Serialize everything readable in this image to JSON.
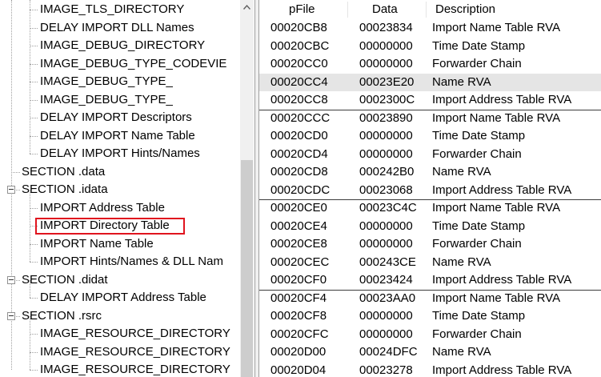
{
  "tree": {
    "items": [
      {
        "label": "IMAGE_TLS_DIRECTORY",
        "level": 2
      },
      {
        "label": "DELAY IMPORT DLL Names",
        "level": 2
      },
      {
        "label": "IMAGE_DEBUG_DIRECTORY",
        "level": 2
      },
      {
        "label": "IMAGE_DEBUG_TYPE_CODEVIE",
        "level": 2
      },
      {
        "label": "IMAGE_DEBUG_TYPE_",
        "level": 2
      },
      {
        "label": "IMAGE_DEBUG_TYPE_",
        "level": 2
      },
      {
        "label": "DELAY IMPORT Descriptors",
        "level": 2
      },
      {
        "label": "DELAY IMPORT Name Table",
        "level": 2
      },
      {
        "label": "DELAY IMPORT Hints/Names",
        "level": 2
      },
      {
        "label": "SECTION .data",
        "level": 1
      },
      {
        "label": "SECTION .idata",
        "level": 1,
        "expanded": true
      },
      {
        "label": "IMPORT Address Table",
        "level": 2
      },
      {
        "label": "IMPORT Directory Table",
        "level": 2,
        "selected": true
      },
      {
        "label": "IMPORT Name Table",
        "level": 2
      },
      {
        "label": "IMPORT Hints/Names & DLL Nam",
        "level": 2
      },
      {
        "label": "SECTION .didat",
        "level": 1,
        "expanded": true
      },
      {
        "label": "DELAY IMPORT Address Table",
        "level": 2
      },
      {
        "label": "SECTION .rsrc",
        "level": 1,
        "expanded": true
      },
      {
        "label": "IMAGE_RESOURCE_DIRECTORY",
        "level": 2
      },
      {
        "label": "IMAGE_RESOURCE_DIRECTORY",
        "level": 2
      },
      {
        "label": "IMAGE_RESOURCE_DIRECTORY",
        "level": 2
      }
    ]
  },
  "table": {
    "columns": [
      "pFile",
      "Data",
      "Description"
    ],
    "rows": [
      {
        "pfile": "00020CB8",
        "data": "00023834",
        "desc": "Import Name Table RVA"
      },
      {
        "pfile": "00020CBC",
        "data": "00000000",
        "desc": "Time Date Stamp"
      },
      {
        "pfile": "00020CC0",
        "data": "00000000",
        "desc": "Forwarder Chain"
      },
      {
        "pfile": "00020CC4",
        "data": "00023E20",
        "desc": "Name RVA",
        "highlight": true
      },
      {
        "pfile": "00020CC8",
        "data": "0002300C",
        "desc": "Import Address Table RVA"
      },
      {
        "pfile": "00020CCC",
        "data": "00023890",
        "desc": "Import Name Table RVA",
        "group_start": true
      },
      {
        "pfile": "00020CD0",
        "data": "00000000",
        "desc": "Time Date Stamp"
      },
      {
        "pfile": "00020CD4",
        "data": "00000000",
        "desc": "Forwarder Chain"
      },
      {
        "pfile": "00020CD8",
        "data": "000242B0",
        "desc": "Name RVA"
      },
      {
        "pfile": "00020CDC",
        "data": "00023068",
        "desc": "Import Address Table RVA"
      },
      {
        "pfile": "00020CE0",
        "data": "00023C4C",
        "desc": "Import Name Table RVA",
        "group_start": true
      },
      {
        "pfile": "00020CE4",
        "data": "00000000",
        "desc": "Time Date Stamp"
      },
      {
        "pfile": "00020CE8",
        "data": "00000000",
        "desc": "Forwarder Chain"
      },
      {
        "pfile": "00020CEC",
        "data": "000243CE",
        "desc": "Name RVA"
      },
      {
        "pfile": "00020CF0",
        "data": "00023424",
        "desc": "Import Address Table RVA"
      },
      {
        "pfile": "00020CF4",
        "data": "00023AA0",
        "desc": "Import Name Table RVA",
        "group_start": true
      },
      {
        "pfile": "00020CF8",
        "data": "00000000",
        "desc": "Time Date Stamp"
      },
      {
        "pfile": "00020CFC",
        "data": "00000000",
        "desc": "Forwarder Chain"
      },
      {
        "pfile": "00020D00",
        "data": "00024DFC",
        "desc": "Name RVA"
      },
      {
        "pfile": "00020D04",
        "data": "00023278",
        "desc": "Import Address Table RVA"
      }
    ]
  },
  "colors": {
    "selection_outline": "#e0141e",
    "row_highlight": "#e5e5e5",
    "group_separator": "#3c3c3c"
  },
  "icons": {
    "scroll_up": "chevron-up-icon",
    "tree_expander": "minus-box-icon"
  }
}
